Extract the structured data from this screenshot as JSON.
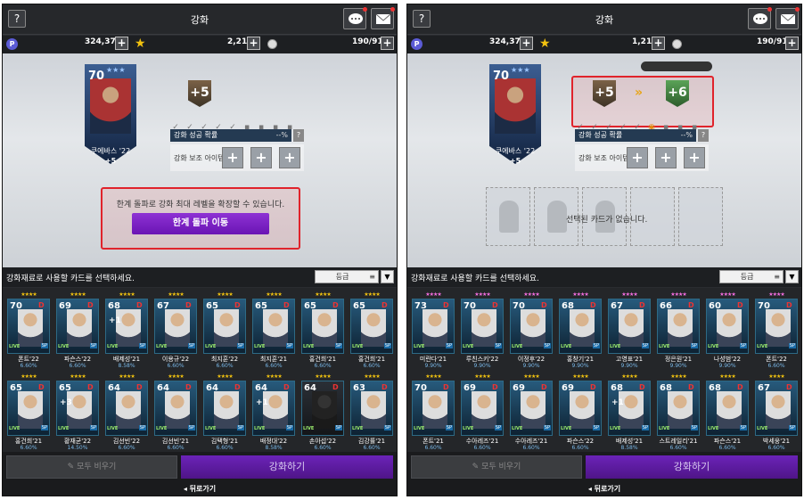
{
  "left": {
    "title": "강화",
    "help": "?",
    "resources": {
      "points": "324,379",
      "stars": "2,215",
      "cards": "190/91"
    },
    "main_card": {
      "overall": "70",
      "name": "쿠에바스 '22",
      "level": "+5"
    },
    "current_level": "+5",
    "prob_label": "강화 성공 확률",
    "prob_value": "--%",
    "aux_label": "강화 보조 아이템",
    "limit_msg": "한계 돌파로 강화 최대 레벨을 확장할 수 있습니다.",
    "limit_btn": "한계 돌파 이동",
    "select_label": "강화재료로 사용할 카드를 선택하세요.",
    "sort_label": "등급",
    "cards": [
      {
        "ovr": "70",
        "name": "폰트'22",
        "pct": "6.60%"
      },
      {
        "ovr": "69",
        "name": "파슨스'22",
        "pct": "6.60%"
      },
      {
        "ovr": "68",
        "name": "배제성'21",
        "pct": "8.58%",
        "bonus": "+1"
      },
      {
        "ovr": "67",
        "name": "이용규'22",
        "pct": "6.60%"
      },
      {
        "ovr": "65",
        "name": "최지훈'22",
        "pct": "6.60%"
      },
      {
        "ovr": "65",
        "name": "최지훈'21",
        "pct": "6.60%"
      },
      {
        "ovr": "65",
        "name": "홍건희'21",
        "pct": "6.60%"
      },
      {
        "ovr": "65",
        "name": "홍건희'21",
        "pct": "6.60%"
      },
      {
        "ovr": "65",
        "name": "홍건희'21",
        "pct": "6.60%"
      },
      {
        "ovr": "65",
        "name": "황재균'22",
        "pct": "14.50%",
        "bonus": "+3"
      },
      {
        "ovr": "64",
        "name": "김선빈'22",
        "pct": "6.60%"
      },
      {
        "ovr": "64",
        "name": "김선빈'21",
        "pct": "6.60%"
      },
      {
        "ovr": "64",
        "name": "김택형'21",
        "pct": "6.60%"
      },
      {
        "ovr": "64",
        "name": "배정대'22",
        "pct": "8.58%",
        "bonus": "+1"
      },
      {
        "ovr": "64",
        "name": "손아섭'22",
        "pct": "6.60%"
      },
      {
        "ovr": "63",
        "name": "김강률'21",
        "pct": "6.60%"
      }
    ],
    "clear_btn": "모두 비우기",
    "enhance_btn": "강화하기",
    "back": "뒤로가기"
  },
  "right": {
    "title": "강화",
    "help": "?",
    "resources": {
      "points": "324,379",
      "stars": "1,215",
      "cards": "190/91"
    },
    "main_card": {
      "overall": "70",
      "name": "쿠에바스 '22",
      "level": "+5"
    },
    "current_level": "+5",
    "next_level": "+6",
    "prob_label": "강화 성공 확률",
    "prob_value": "--%",
    "aux_label": "강화 보조 아이템",
    "empty_msg": "선택된 카드가 없습니다.",
    "select_label": "강화재료로 사용할 카드를 선택하세요.",
    "sort_label": "등급",
    "cards": [
      {
        "ovr": "73",
        "name": "미란다'21",
        "pct": "9.90%"
      },
      {
        "ovr": "70",
        "name": "루친스키'22",
        "pct": "9.90%"
      },
      {
        "ovr": "70",
        "name": "이정후'22",
        "pct": "9.90%"
      },
      {
        "ovr": "68",
        "name": "홍창기'21",
        "pct": "9.90%"
      },
      {
        "ovr": "67",
        "name": "고영표'21",
        "pct": "9.90%"
      },
      {
        "ovr": "66",
        "name": "정은원'21",
        "pct": "9.90%"
      },
      {
        "ovr": "60",
        "name": "나성범'22",
        "pct": "9.90%"
      },
      {
        "ovr": "70",
        "name": "폰트'22",
        "pct": "6.60%"
      },
      {
        "ovr": "70",
        "name": "폰트'21",
        "pct": "6.60%"
      },
      {
        "ovr": "69",
        "name": "수아레즈'21",
        "pct": "6.60%"
      },
      {
        "ovr": "69",
        "name": "수아레즈'21",
        "pct": "6.60%"
      },
      {
        "ovr": "69",
        "name": "파슨스'22",
        "pct": "6.60%"
      },
      {
        "ovr": "68",
        "name": "배제성'21",
        "pct": "8.58%",
        "bonus": "+1"
      },
      {
        "ovr": "68",
        "name": "스트레일리'21",
        "pct": "6.60%"
      },
      {
        "ovr": "68",
        "name": "파슨스'21",
        "pct": "6.60%"
      },
      {
        "ovr": "67",
        "name": "박세웅'21",
        "pct": "6.60%"
      }
    ],
    "clear_btn": "모두 비우기",
    "enhance_btn": "강화하기",
    "back": "뒤로가기"
  }
}
